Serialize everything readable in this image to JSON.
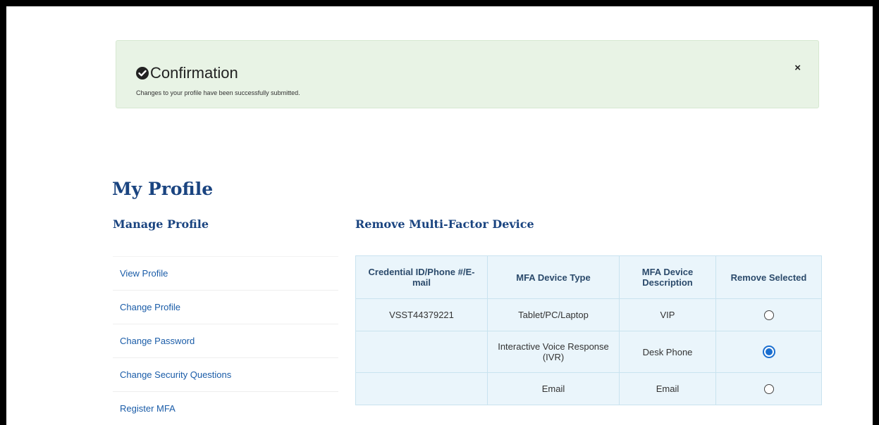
{
  "alert": {
    "title": "Confirmation",
    "message": "Changes to your profile have been successfully submitted.",
    "close_label": "×",
    "icon": "check-circle-icon"
  },
  "page_title": "My Profile",
  "sidebar": {
    "title": "Manage Profile",
    "items": [
      {
        "label": "View Profile"
      },
      {
        "label": "Change Profile"
      },
      {
        "label": "Change Password"
      },
      {
        "label": "Change Security Questions"
      },
      {
        "label": "Register MFA"
      }
    ]
  },
  "main": {
    "title": "Remove Multi-Factor Device",
    "table": {
      "headers": [
        "Credential ID/Phone #/E-mail",
        "MFA Device Type",
        "MFA Device Description",
        "Remove Selected"
      ],
      "rows": [
        {
          "credential": "VSST44379221",
          "type": "Tablet/PC/Laptop",
          "description": "VIP",
          "selected": false
        },
        {
          "credential": "",
          "type": "Interactive Voice Response (IVR)",
          "description": "Desk Phone",
          "selected": true
        },
        {
          "credential": "",
          "type": "Email",
          "description": "Email",
          "selected": false
        }
      ]
    }
  },
  "colors": {
    "alert_bg": "#e8f3e5",
    "heading": "#1a4480",
    "link": "#1a5ca8",
    "table_bg": "#eaf5fb",
    "radio_selected": "#1b6fd0"
  }
}
